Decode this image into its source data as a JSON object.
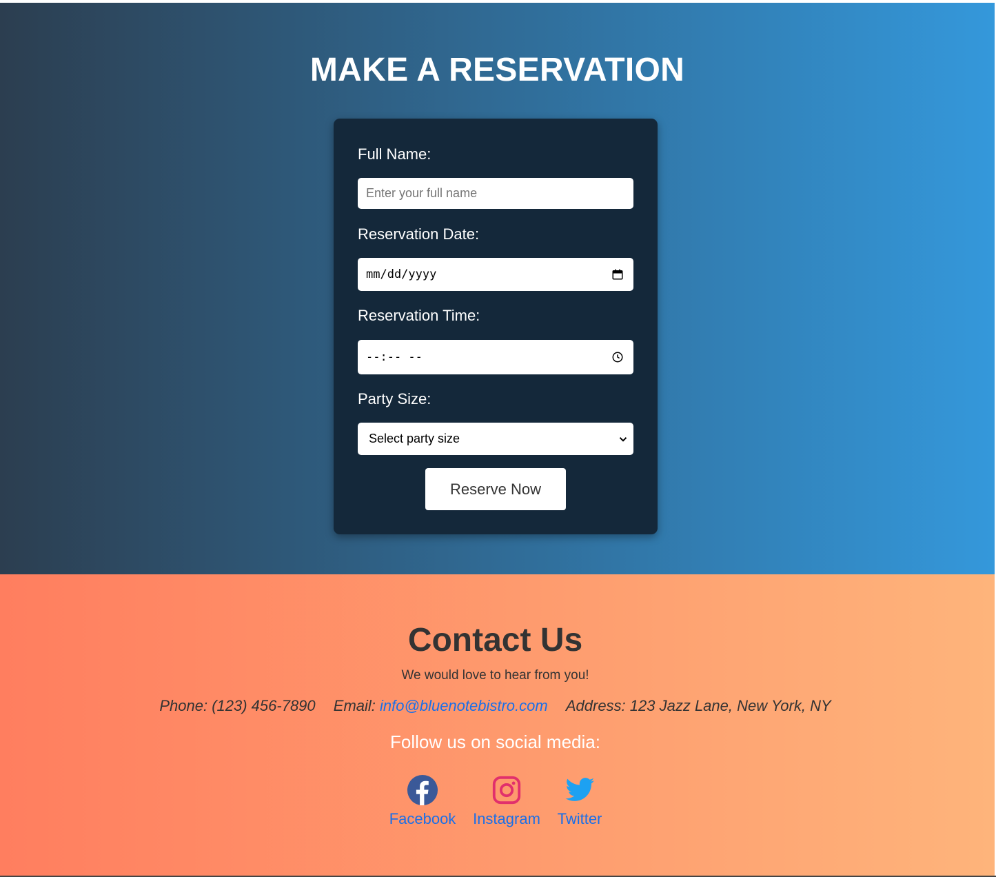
{
  "reservation": {
    "title": "MAKE A RESERVATION",
    "background_colors": [
      "#2c3e50",
      "#3498db"
    ],
    "form": {
      "name_label": "Full Name:",
      "name_placeholder": "Enter your full name",
      "date_label": "Reservation Date:",
      "date_value": "mm/dd/yyyy",
      "time_label": "Reservation Time:",
      "time_value": "--:-- --",
      "party_label": "Party Size:",
      "party_value": "Select party size",
      "submit_label": "Reserve Now",
      "card_color": "#14283a"
    }
  },
  "contact": {
    "title": "Contact Us",
    "subtitle": "We would love to hear from you!",
    "phone": "Phone: (123) 456-7890",
    "email_prefix": "Email: ",
    "email": "info@bluenotebistro.com",
    "address": "Address: 123 Jazz Lane, New York, NY",
    "follow": "Follow us on social media:",
    "background_colors": [
      "#ff7e5f",
      "#feb47b"
    ],
    "social": [
      {
        "label": "Facebook",
        "icon": "facebook-icon",
        "color": "#3b5998"
      },
      {
        "label": "Instagram",
        "icon": "instagram-icon",
        "color": "#e1306c"
      },
      {
        "label": "Twitter",
        "icon": "twitter-icon",
        "color": "#1da1f2"
      }
    ]
  }
}
